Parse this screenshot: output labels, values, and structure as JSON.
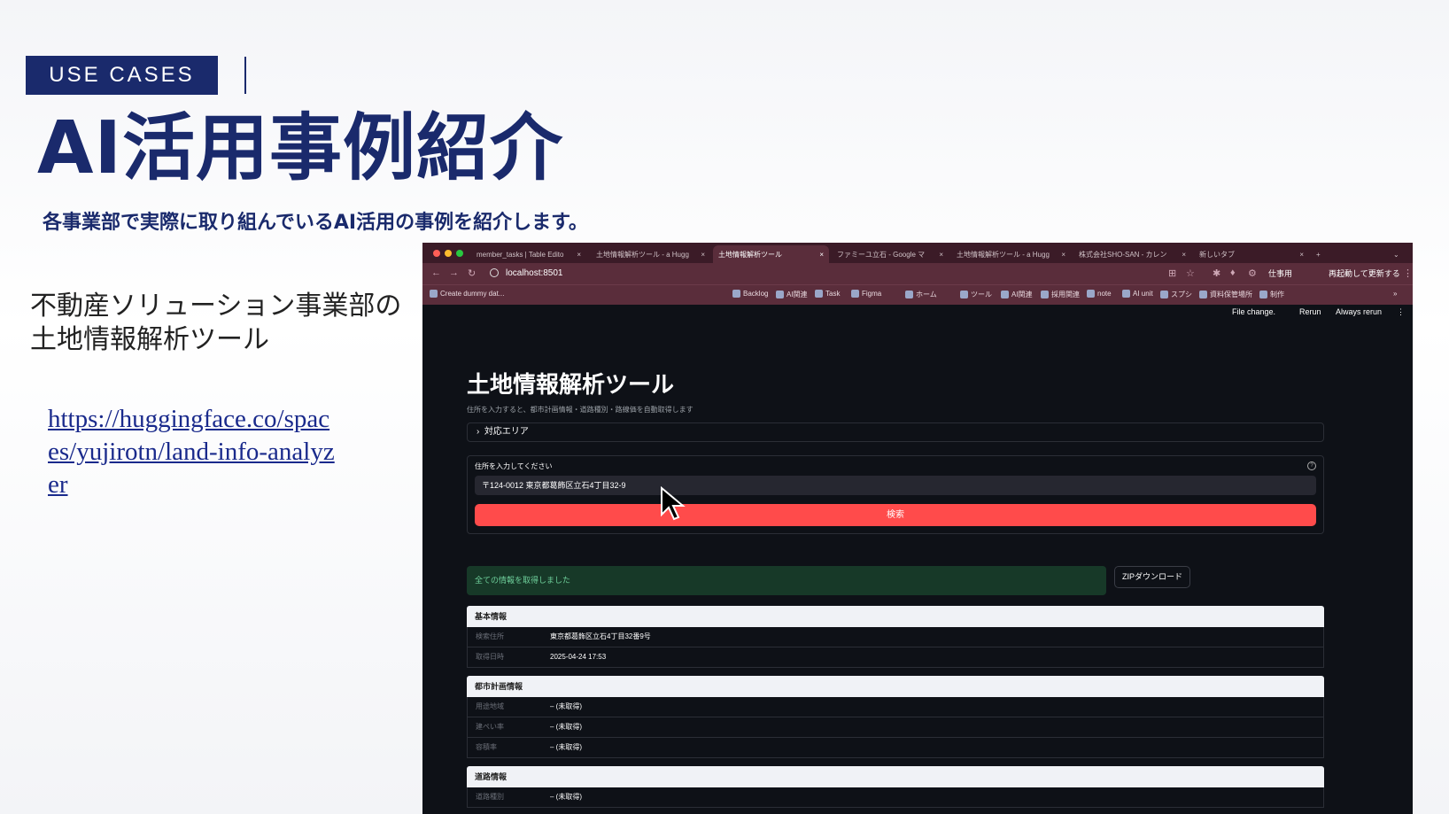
{
  "slide": {
    "badge": "USE CASES",
    "title": "AI活用事例紹介",
    "subtitle": "各事業部で実際に取り組んでいるAI活用の事例を紹介します。",
    "case_title_line1": "不動産ソリューション事業部の",
    "case_title_line2": "土地情報解析ツール",
    "case_link": "https://huggingface.co/spaces/yujirotn/land-info-analyzer"
  },
  "browser": {
    "tabs": [
      {
        "label": "member_tasks | Table Edito"
      },
      {
        "label": "土地情報解析ツール - a Hugg"
      },
      {
        "label": "土地情報解析ツール"
      },
      {
        "label": "ファミーユ立石 - Google マ"
      },
      {
        "label": "土地情報解析ツール - a Hugg"
      },
      {
        "label": "株式会社SHO-SAN - カレン"
      },
      {
        "label": "新しいタブ"
      }
    ],
    "url": "localhost:8501",
    "profile_label": "仕事用",
    "update_label": "再起動して更新する",
    "bookmarks": [
      "Create dummy dat...",
      "Backlog",
      "AI関連",
      "Task",
      "Figma",
      "ホーム",
      "ツール",
      "AI関連",
      "採用関連",
      "note",
      "AI unit",
      "スプシ",
      "資料保管場所",
      "制作"
    ]
  },
  "app": {
    "file_change": "File change.",
    "rerun": "Rerun",
    "always_rerun": "Always rerun",
    "heading": "土地情報解析ツール",
    "caption": "住所を入力すると、都市計画情報・道路種別・路線価を自動取得します",
    "expander": "対応エリア",
    "input_label": "住所を入力してください",
    "input_value": "〒124-0012 東京都葛飾区立石4丁目32-9",
    "search_button": "検索",
    "success_message": "全ての情報を取得しました",
    "zip_button": "ZIPダウンロード",
    "sections": [
      {
        "title": "基本情報",
        "rows": [
          {
            "key": "検索住所",
            "value": "東京都葛飾区立石4丁目32番9号"
          },
          {
            "key": "取得日時",
            "value": "2025-04-24 17:53"
          }
        ]
      },
      {
        "title": "都市計画情報",
        "rows": [
          {
            "key": "用途地域",
            "value": "– (未取得)"
          },
          {
            "key": "建ぺい率",
            "value": "– (未取得)"
          },
          {
            "key": "容積率",
            "value": "– (未取得)"
          }
        ]
      },
      {
        "title": "道路情報",
        "rows": [
          {
            "key": "道路種別",
            "value": "– (未取得)"
          }
        ]
      }
    ]
  }
}
